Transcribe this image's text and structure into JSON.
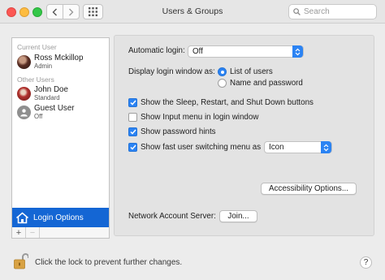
{
  "window": {
    "title": "Users & Groups"
  },
  "search": {
    "placeholder": "Search"
  },
  "sidebar": {
    "current_user_heading": "Current User",
    "other_users_heading": "Other Users",
    "users": [
      {
        "name": "Ross Mckillop",
        "role": "Admin"
      },
      {
        "name": "John Doe",
        "role": "Standard"
      },
      {
        "name": "Guest User",
        "role": "Off"
      }
    ],
    "login_options_label": "Login Options",
    "add_label": "+",
    "remove_label": "−"
  },
  "panel": {
    "automatic_login_label": "Automatic login:",
    "automatic_login_value": "Off",
    "display_login_label": "Display login window as:",
    "radio_list_of_users": "List of users",
    "radio_name_and_password": "Name and password",
    "selected_display_option": "List of users",
    "checkboxes": [
      {
        "label": "Show the Sleep, Restart, and Shut Down buttons",
        "checked": true
      },
      {
        "label": "Show Input menu in login window",
        "checked": false
      },
      {
        "label": "Show password hints",
        "checked": true
      },
      {
        "label": "Show fast user switching menu as",
        "checked": true
      }
    ],
    "fast_user_switching_value": "Icon",
    "accessibility_button": "Accessibility Options...",
    "network_account_label": "Network Account Server:",
    "join_button": "Join..."
  },
  "footer": {
    "lock_text": "Click the lock to prevent further changes.",
    "help_label": "?"
  },
  "colors": {
    "accent": "#2b83f3",
    "selection": "#1466d4"
  }
}
